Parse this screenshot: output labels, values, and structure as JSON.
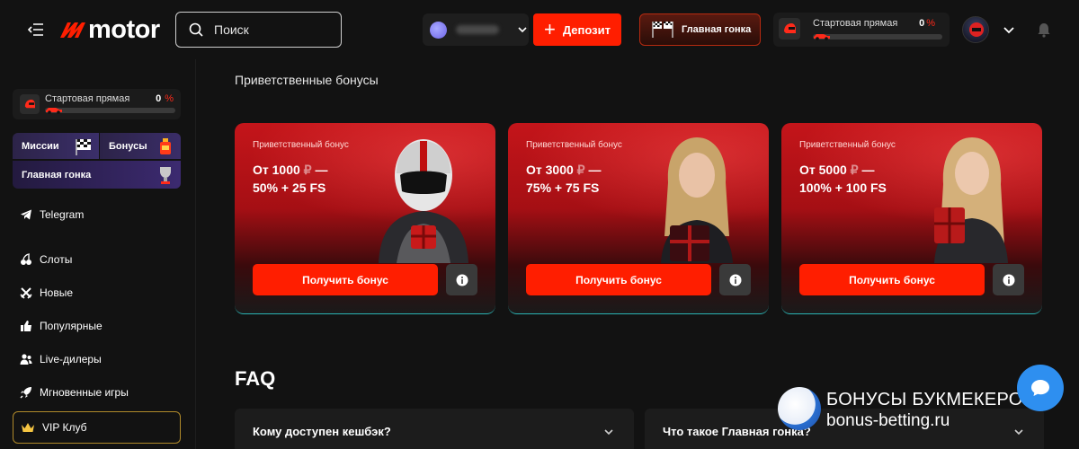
{
  "header": {
    "logo_text": "motor",
    "search_placeholder": "Поиск",
    "deposit_label": "Депозит",
    "grand_race_label": "Главная гонка",
    "race_widget": {
      "title": "Стартовая прямая",
      "percent": "0",
      "percent_sign": "%",
      "progress": 0
    }
  },
  "sidebar": {
    "race": {
      "title": "Стартовая прямая",
      "percent": "0",
      "percent_sign": "%",
      "progress": 0
    },
    "tiles": {
      "missions": "Миссии",
      "bonuses": "Бонусы",
      "grand_race": "Главная гонка"
    },
    "items": [
      {
        "label": "Telegram",
        "icon": "telegram-icon"
      },
      {
        "label": "Слоты",
        "icon": "cherries-icon"
      },
      {
        "label": "Новые",
        "icon": "crossed-swords-icon"
      },
      {
        "label": "Популярные",
        "icon": "thumbs-up-icon"
      },
      {
        "label": "Live-дилеры",
        "icon": "users-icon"
      },
      {
        "label": "Мгновенные игры",
        "icon": "rocket-icon"
      }
    ],
    "vip_label": "VIP Клуб"
  },
  "main": {
    "section_title": "Приветственные бонусы",
    "cards": [
      {
        "label": "Приветственный бонус",
        "amount_prefix": "От 1000",
        "amount_suffix": "—",
        "bonus": "50% + 25 FS",
        "button": "Получить бонус"
      },
      {
        "label": "Приветственный бонус",
        "amount_prefix": "От 3000",
        "amount_suffix": "—",
        "bonus": "75% + 75 FS",
        "button": "Получить бонус"
      },
      {
        "label": "Приветственный бонус",
        "amount_prefix": "От 5000",
        "amount_suffix": "—",
        "bonus": "100% + 100 FS",
        "button": "Получить бонус"
      }
    ],
    "faq_title": "FAQ",
    "faq": [
      {
        "question": "Кому доступен кешбэк?"
      },
      {
        "question": "Что такое Главная гонка?"
      }
    ]
  },
  "watermark": {
    "line1": "БОНУСЫ БУКМЕКЕРОВ",
    "line2": "bonus-betting.ru"
  },
  "colors": {
    "accent": "#ff1e00",
    "background": "#121212",
    "vip_border": "#b08a2a",
    "chat": "#2e8ff0"
  }
}
